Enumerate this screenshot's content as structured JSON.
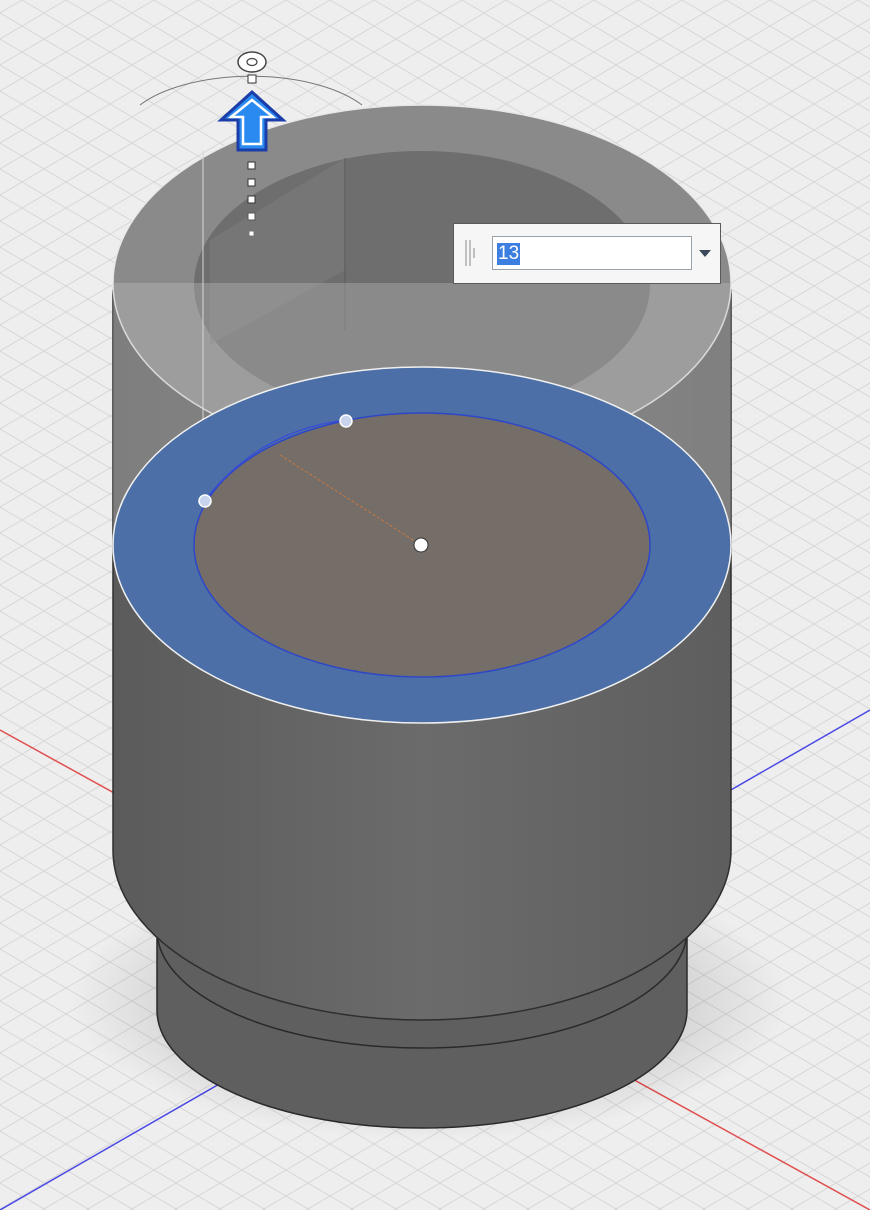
{
  "extent_input": {
    "value": "13",
    "value_selected": true
  },
  "colors": {
    "background": "#eeeeee",
    "grid": "#d4d4d4",
    "axis_x": "#e05050",
    "axis_y": "#4a4ae6",
    "body": "#6a6a6a",
    "profile_fill": "#4b6fa6",
    "selection_blue": "#2a8af0"
  },
  "icons": {
    "manipulator": "extrude-arrow-icon",
    "dropdown": "chevron-down-icon",
    "grip": "grip-icon"
  }
}
